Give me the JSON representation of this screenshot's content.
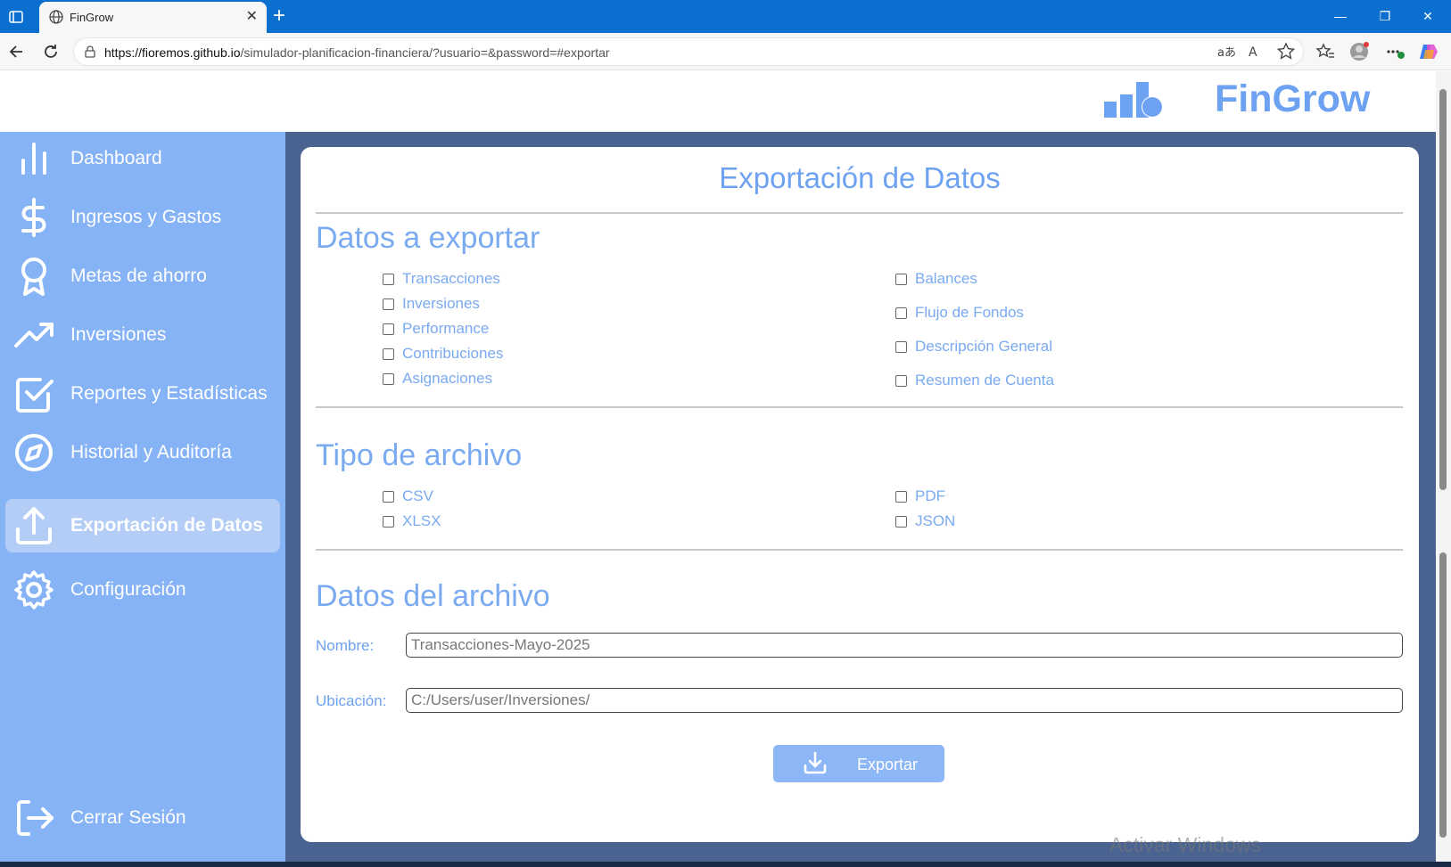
{
  "browser": {
    "tab_title": "FinGrow",
    "url_host": "https://fioremos.github.io",
    "url_path": "/simulador-planificacion-financiera/?usuario=&password=#exportar",
    "colors": {
      "tabbar": "#0b6fd0",
      "chrome": "#f7f7f7"
    }
  },
  "header": {
    "brand": "FinGrow",
    "logo_icon": "chart-coins-icon"
  },
  "sidebar": {
    "items": [
      {
        "label": "Dashboard",
        "icon": "bar-chart-icon"
      },
      {
        "label": "Ingresos y Gastos",
        "icon": "dollar-icon"
      },
      {
        "label": "Metas de ahorro",
        "icon": "award-icon"
      },
      {
        "label": "Inversiones",
        "icon": "trending-up-icon"
      },
      {
        "label": "Reportes y Estadísticas",
        "icon": "check-square-icon"
      },
      {
        "label": "Historial y Auditoría",
        "icon": "compass-icon"
      },
      {
        "label": "Exportación de Datos",
        "icon": "upload-icon",
        "active": true
      },
      {
        "label": "Configuración",
        "icon": "gear-icon"
      }
    ],
    "logout": {
      "label": "Cerrar Sesión",
      "icon": "logout-icon"
    }
  },
  "main": {
    "title": "Exportación de Datos",
    "data_section": {
      "title": "Datos a exportar",
      "left_options": [
        "Transacciones",
        "Inversiones",
        "Performance",
        "Contribuciones",
        "Asignaciones"
      ],
      "right_options": [
        "Balances",
        "Flujo de Fondos",
        "Descripción General",
        "Resumen de Cuenta"
      ]
    },
    "file_type_section": {
      "title": "Tipo de archivo",
      "left_options": [
        "CSV",
        "XLSX"
      ],
      "right_options": [
        "PDF",
        "JSON"
      ]
    },
    "file_section": {
      "title": "Datos del archivo",
      "name_label": "Nombre:",
      "name_value": "Transacciones-Mayo-2025",
      "location_label": "Ubicación:",
      "location_value": "C:/Users/user/Inversiones/"
    },
    "export_button": {
      "label": "Exportar",
      "icon": "download-icon"
    }
  },
  "watermark": "Activar Windows",
  "colors": {
    "accent": "#6da2f2",
    "sidebar": "#86b2f6",
    "background": "#4a6390"
  }
}
